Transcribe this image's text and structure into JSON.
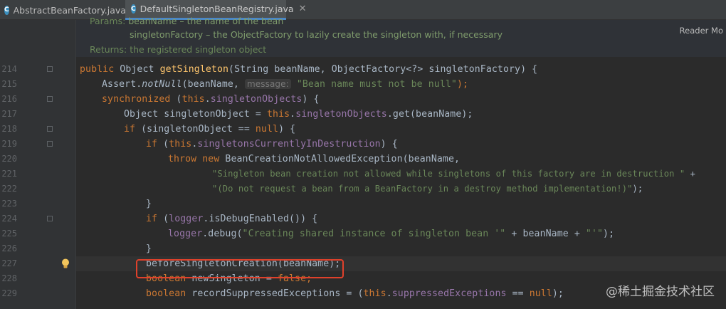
{
  "tabs": [
    {
      "label": "AbstractBeanFactory.java",
      "icon": "class-c-icon",
      "active": false
    },
    {
      "label": "DefaultSingletonBeanRegistry.java",
      "icon": "class-c-icon",
      "active": true
    }
  ],
  "doc": {
    "params_label": "Params:",
    "param1": "beanName – the name of the bean",
    "param2": "singletonFactory – the ObjectFactory to lazily create the singleton with, if necessary",
    "returns_label": "Returns:",
    "returns_text": "the registered singleton object"
  },
  "reader_mode": "Reader Mo",
  "lines": {
    "l214": {
      "num": "214",
      "t1": "public ",
      "t2": "Object ",
      "t3": "getSingleton",
      "t4": "(String beanName, ObjectFactory<?> singletonFactory) {"
    },
    "l215": {
      "num": "215",
      "t1": "Assert.",
      "t2": "notNull",
      "t3": "(beanName, ",
      "hint": "message:",
      "t4": "\"Bean name must not be null\"",
      "t5": ");"
    },
    "l216": {
      "num": "216",
      "t1": "synchronized ",
      "t2": "(",
      "t3": "this",
      "t4": ".",
      "t5": "singletonObjects",
      "t6": ") {"
    },
    "l217": {
      "num": "217",
      "t1": "Object singletonObject = ",
      "t2": "this",
      "t3": ".",
      "t4": "singletonObjects",
      "t5": ".get(beanName);"
    },
    "l218": {
      "num": "218",
      "t1": "if ",
      "t2": "(singletonObject == ",
      "t3": "null",
      "t4": ") {"
    },
    "l219": {
      "num": "219",
      "t1": "if ",
      "t2": "(",
      "t3": "this",
      "t4": ".",
      "t5": "singletonsCurrentlyInDestruction",
      "t6": ") {"
    },
    "l220": {
      "num": "220",
      "t1": "throw new ",
      "t2": "BeanCreationNotAllowedException(beanName,"
    },
    "l221": {
      "num": "221",
      "t1": "\"Singleton bean creation not allowed while singletons of this factory are in destruction \"",
      "t2": " +"
    },
    "l222": {
      "num": "222",
      "t1": "\"(Do not request a bean from a BeanFactory in a destroy method implementation!)\"",
      "t2": ");"
    },
    "l223": {
      "num": "223",
      "t1": "}"
    },
    "l224": {
      "num": "224",
      "t1": "if ",
      "t2": "(",
      "t3": "logger",
      "t4": ".isDebugEnabled()) {"
    },
    "l225": {
      "num": "225",
      "t1": "logger",
      "t2": ".debug(",
      "t3": "\"Creating shared instance of singleton bean '\"",
      "t4": " + beanName + ",
      "t5": "\"'\"",
      "t6": ");"
    },
    "l226": {
      "num": "226",
      "t1": "}"
    },
    "l227": {
      "num": "227",
      "t1": "beforeSingletonCreation(beanName);"
    },
    "l228": {
      "num": "228",
      "t1": "boolean ",
      "t2": "newSingleton = ",
      "t3": "false",
      "t4": ";"
    },
    "l229": {
      "num": "229",
      "t1": "boolean ",
      "t2": "recordSuppressedExceptions = (",
      "t3": "this",
      "t4": ".",
      "t5": "suppressedExceptions",
      "t6": " == ",
      "t7": "null",
      "t8": ");"
    }
  },
  "watermark": "@稀土掘金技术社区",
  "colors": {
    "background": "#2b2b2b",
    "keyword": "#cc7832",
    "string": "#6a8759",
    "field": "#9876aa",
    "method": "#ffc66d",
    "highlight": "#e0412b"
  }
}
